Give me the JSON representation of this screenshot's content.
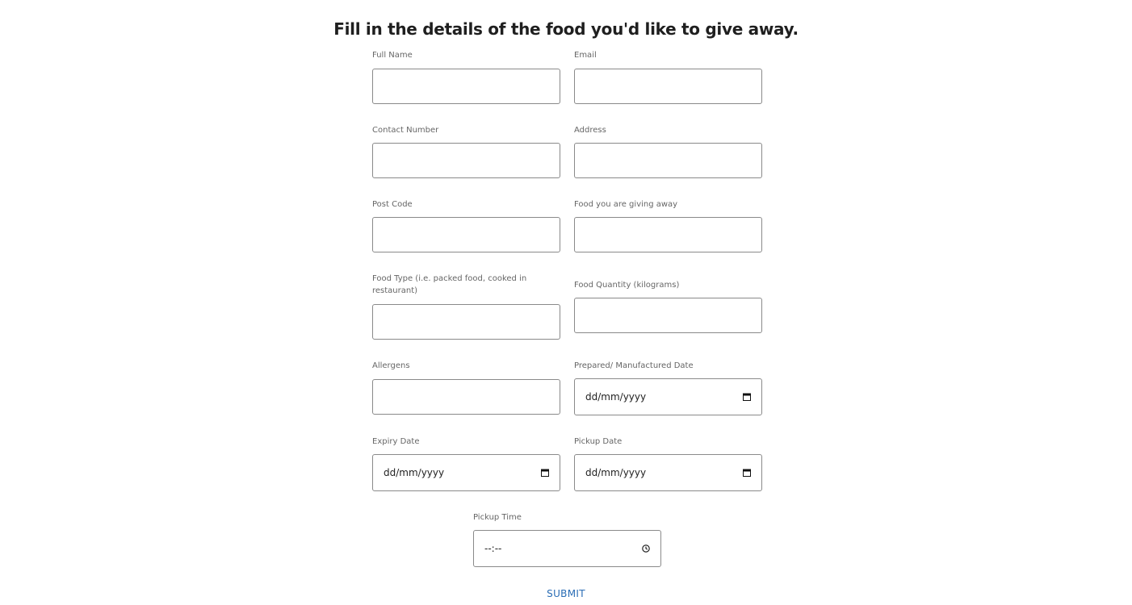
{
  "form": {
    "title": "Fill in the details of the food you'd like to give away.",
    "fields": {
      "full_name": {
        "label": "Full Name",
        "value": ""
      },
      "email": {
        "label": "Email",
        "value": ""
      },
      "contact_number": {
        "label": "Contact Number",
        "value": ""
      },
      "address": {
        "label": "Address",
        "value": ""
      },
      "post_code": {
        "label": "Post Code",
        "value": ""
      },
      "food_giving": {
        "label": "Food you are giving away",
        "value": ""
      },
      "food_type": {
        "label": "Food Type (i.e. packed food, cooked in restaurant)",
        "value": ""
      },
      "food_quantity": {
        "label": "Food Quantity (kilograms)",
        "value": ""
      },
      "allergens": {
        "label": "Allergens",
        "value": ""
      },
      "prepared_date": {
        "label": "Prepared/ Manufactured Date",
        "placeholder": "dd/mm/yyyy"
      },
      "expiry_date": {
        "label": "Expiry Date",
        "placeholder": "dd/mm/yyyy"
      },
      "pickup_date": {
        "label": "Pickup Date",
        "placeholder": "dd/mm/yyyy"
      },
      "pickup_time": {
        "label": "Pickup Time",
        "placeholder": "--:--"
      }
    },
    "submit_label": "SUBMIT",
    "icons": {
      "date": "calendar-icon",
      "time": "clock-icon"
    },
    "colors": {
      "title": "#1f1f1f",
      "label": "#666666",
      "border": "#8a8a8a",
      "submit": "#2a6db5"
    }
  }
}
